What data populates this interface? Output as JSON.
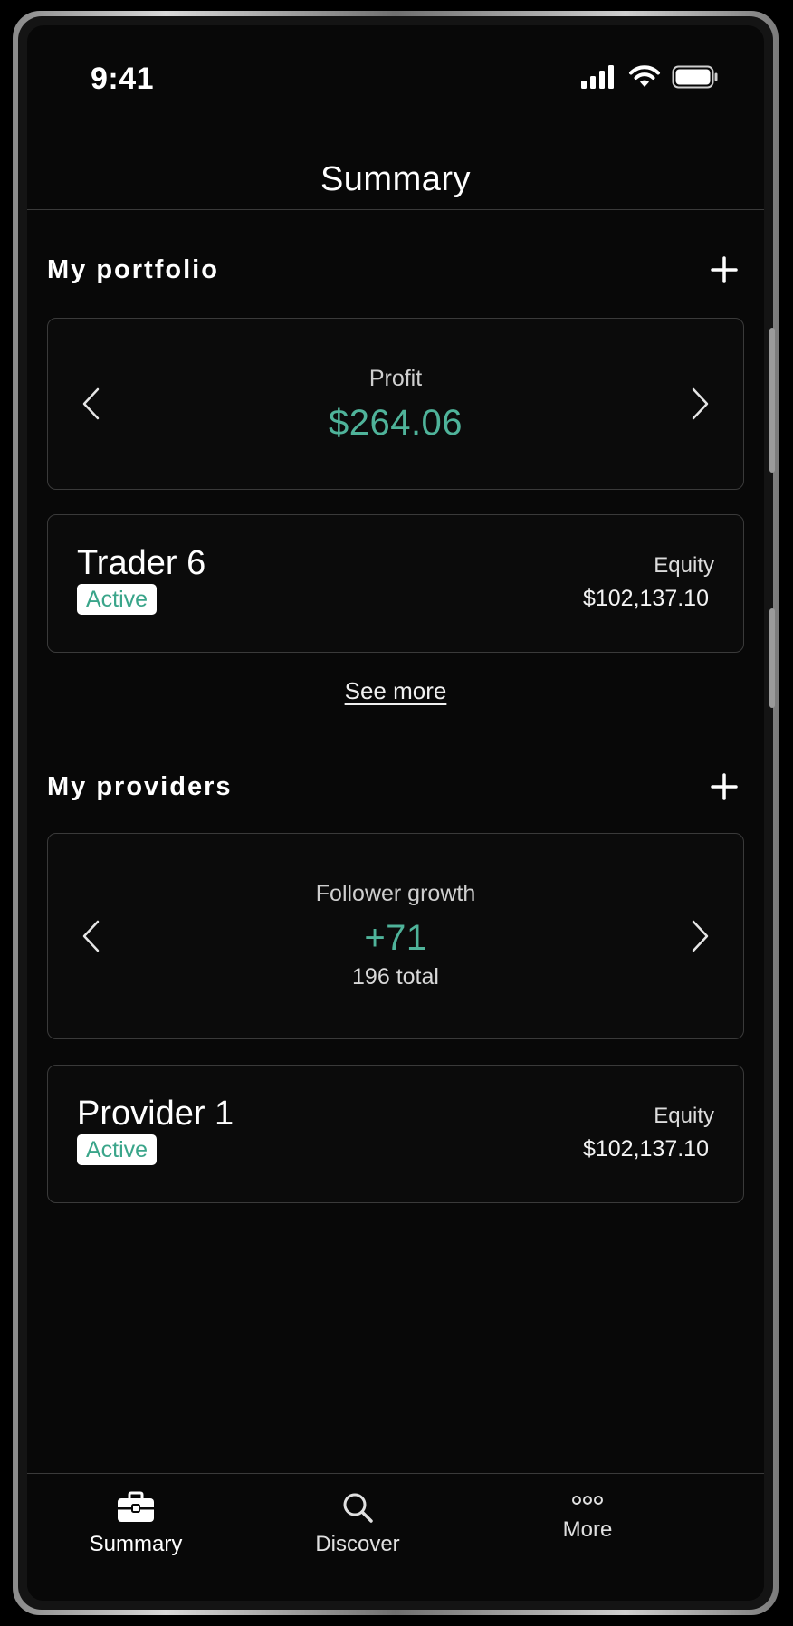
{
  "status_bar": {
    "time": "9:41"
  },
  "header": {
    "title": "Summary"
  },
  "portfolio": {
    "title": "My portfolio",
    "carousel": {
      "label": "Profit",
      "value": "$264.06"
    },
    "item": {
      "name": "Trader 6",
      "status": "Active",
      "equity_label": "Equity",
      "equity_value": "$102,137.10"
    },
    "see_more": "See more"
  },
  "providers": {
    "title": "My providers",
    "carousel": {
      "label": "Follower growth",
      "value": "+71",
      "sub": "196 total"
    },
    "item": {
      "name": "Provider 1",
      "status": "Active",
      "equity_label": "Equity",
      "equity_value": "$102,137.10"
    }
  },
  "nav": {
    "items": [
      {
        "label": "Summary",
        "icon": "briefcase-icon",
        "active": true
      },
      {
        "label": "Discover",
        "icon": "search-icon",
        "active": false
      },
      {
        "label": "More",
        "icon": "more-icon",
        "active": false
      }
    ]
  },
  "colors": {
    "accent": "#4fb39a",
    "background": "#080808",
    "card_border": "#3a3a3a"
  }
}
